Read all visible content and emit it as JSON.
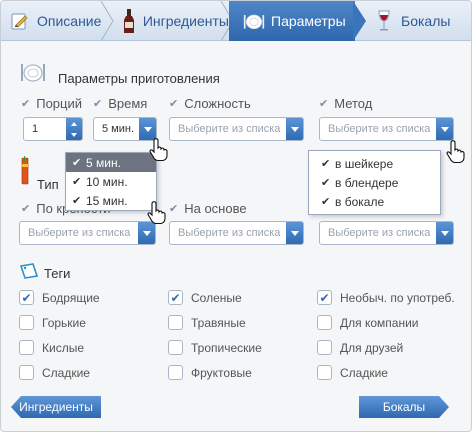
{
  "tabs": [
    {
      "label": "Описание",
      "icon": "pencil-icon"
    },
    {
      "label": "Ингредиенты",
      "icon": "bottle-icon"
    },
    {
      "label": "Параметры",
      "icon": "plate-icon",
      "active": true
    },
    {
      "label": "Бокалы",
      "icon": "wine-glass-icon"
    }
  ],
  "prep": {
    "title": "Параметры приготовления",
    "portions_label": "Порций",
    "portions_value": "1",
    "time_label": "Время",
    "time_value": "5 мин.",
    "time_options": [
      "5 мин.",
      "10 мин.",
      "15 мин."
    ],
    "complexity_label": "Сложность",
    "complexity_placeholder": "Выберите из списка",
    "method_label": "Метод",
    "method_placeholder": "Выберите из списка",
    "method_options": [
      "в шейкере",
      "в блендере",
      "в бокале"
    ]
  },
  "type": {
    "title": "Тип",
    "strength_label": "По крепости",
    "strength_placeholder": "Выберите из списка",
    "base_label": "На основе",
    "base_placeholder": "Выберите из списка",
    "third_placeholder": "Выберите из списка"
  },
  "tags": {
    "title": "Теги",
    "items": [
      {
        "label": "Бодрящие",
        "checked": true
      },
      {
        "label": "Соленые",
        "checked": true
      },
      {
        "label": "Необыч. по употреб.",
        "checked": true
      },
      {
        "label": "Горькие",
        "checked": false
      },
      {
        "label": "Травяные",
        "checked": false
      },
      {
        "label": "Для компании",
        "checked": false
      },
      {
        "label": "Кислые",
        "checked": false
      },
      {
        "label": "Тропические",
        "checked": false
      },
      {
        "label": "Для друзей",
        "checked": false
      },
      {
        "label": "Сладкие",
        "checked": false
      },
      {
        "label": "Фруктовые",
        "checked": false
      },
      {
        "label": "Сладкие",
        "checked": false
      }
    ]
  },
  "footer": {
    "back_label": "Ингредиенты",
    "next_label": "Бокалы"
  },
  "colors": {
    "accent": "#2f6ab3",
    "tab_text": "#2e5a94"
  }
}
